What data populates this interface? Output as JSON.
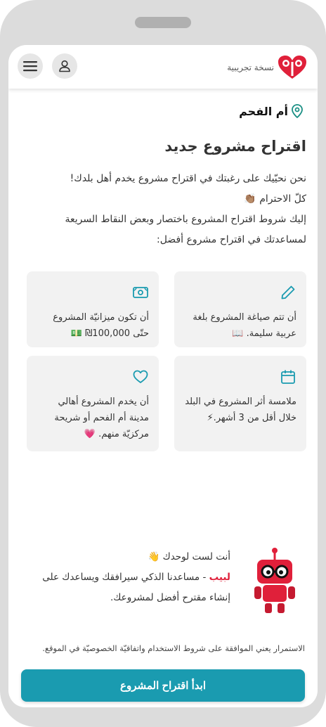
{
  "header": {
    "logo_text": "نسخة تجريبية",
    "user_icon": "user-icon",
    "menu_icon": "hamburger-menu-icon"
  },
  "location": {
    "icon": "map-pin-icon",
    "name": "أم الفحم"
  },
  "page_title": "اقتراح مشروع جديد",
  "intro": {
    "line1": "نحن نحيّيك على رغبتك في اقتراح مشروع يخدم أهل بلدك!",
    "line2": "كلّ الاحترام 👏🏽",
    "line3": "إليك شروط اقتراح المشروع باختصار وبعض النقاط السريعة",
    "line4": "لمساعدتك في اقتراح مشروع أفضل:"
  },
  "cards": [
    {
      "icon": "pencil-icon",
      "line1": "أن تتم صياغة المشروع بلغة",
      "line2": "عربية سليمة. 📖"
    },
    {
      "icon": "money-icon",
      "line1": "أن تكون ميزانيّة المشروع",
      "line2": "حتّى 100,000₪ 💵"
    },
    {
      "icon": "calendar-icon",
      "line1": "ملامسة أثر المشروع في البلد",
      "line2": "خلال أقل من 3 أشهر.⚡"
    },
    {
      "icon": "heart-icon",
      "line1": "أن يخدم المشروع أهالي",
      "line2": "مدينة أم الفحم أو شريحة",
      "line3": "مركزيّة منهم. 💗"
    }
  ],
  "helper": {
    "line1": "أنت لست لوحدك 👋",
    "brand": "لبيب",
    "line2_rest": " - مساعدنا الذكي سيرافقك ويساعدك على",
    "line3": "إنشاء مقترح أفضل لمشروعك."
  },
  "terms": "الاستمرار يعني الموافقة على شروط الاستخدام واتفاقيّة الخصوصيّة في الموقع.",
  "cta_label": "ابدأ اقتراح المشروع",
  "colors": {
    "accent": "#1a9bb0",
    "brand_red": "#e0203a",
    "card_bg": "#f2f2f2"
  }
}
